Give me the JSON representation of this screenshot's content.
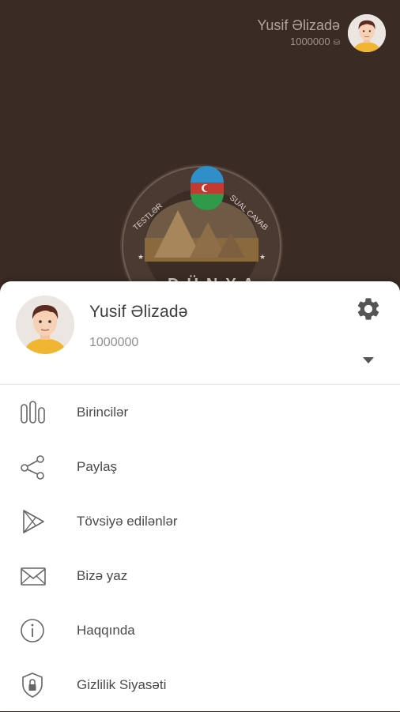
{
  "header": {
    "user_name": "Yusif Əlizadə",
    "coins": "1000000",
    "coin_icon": "coin-icon"
  },
  "logo": {
    "arc_left": "TESTLƏR",
    "arc_right": "SUAL CAVAB",
    "bottom_text": "DÜNYA"
  },
  "profile": {
    "name": "Yusif Əlizadə",
    "coins": "1000000"
  },
  "menu": {
    "items": [
      {
        "label": "Birincilər",
        "icon": "leaderboard-icon"
      },
      {
        "label": "Paylaş",
        "icon": "share-icon"
      },
      {
        "label": "Tövsiyə edilənlər",
        "icon": "play-store-icon"
      },
      {
        "label": "Bizə yaz",
        "icon": "mail-icon"
      },
      {
        "label": "Haqqında",
        "icon": "info-icon"
      },
      {
        "label": "Gizlilik Siyasəti",
        "icon": "privacy-shield-icon"
      }
    ]
  },
  "colors": {
    "background": "#3a2b24",
    "sheet": "#ffffff",
    "text": "#4a4a4a",
    "muted": "#8f8f8f"
  }
}
